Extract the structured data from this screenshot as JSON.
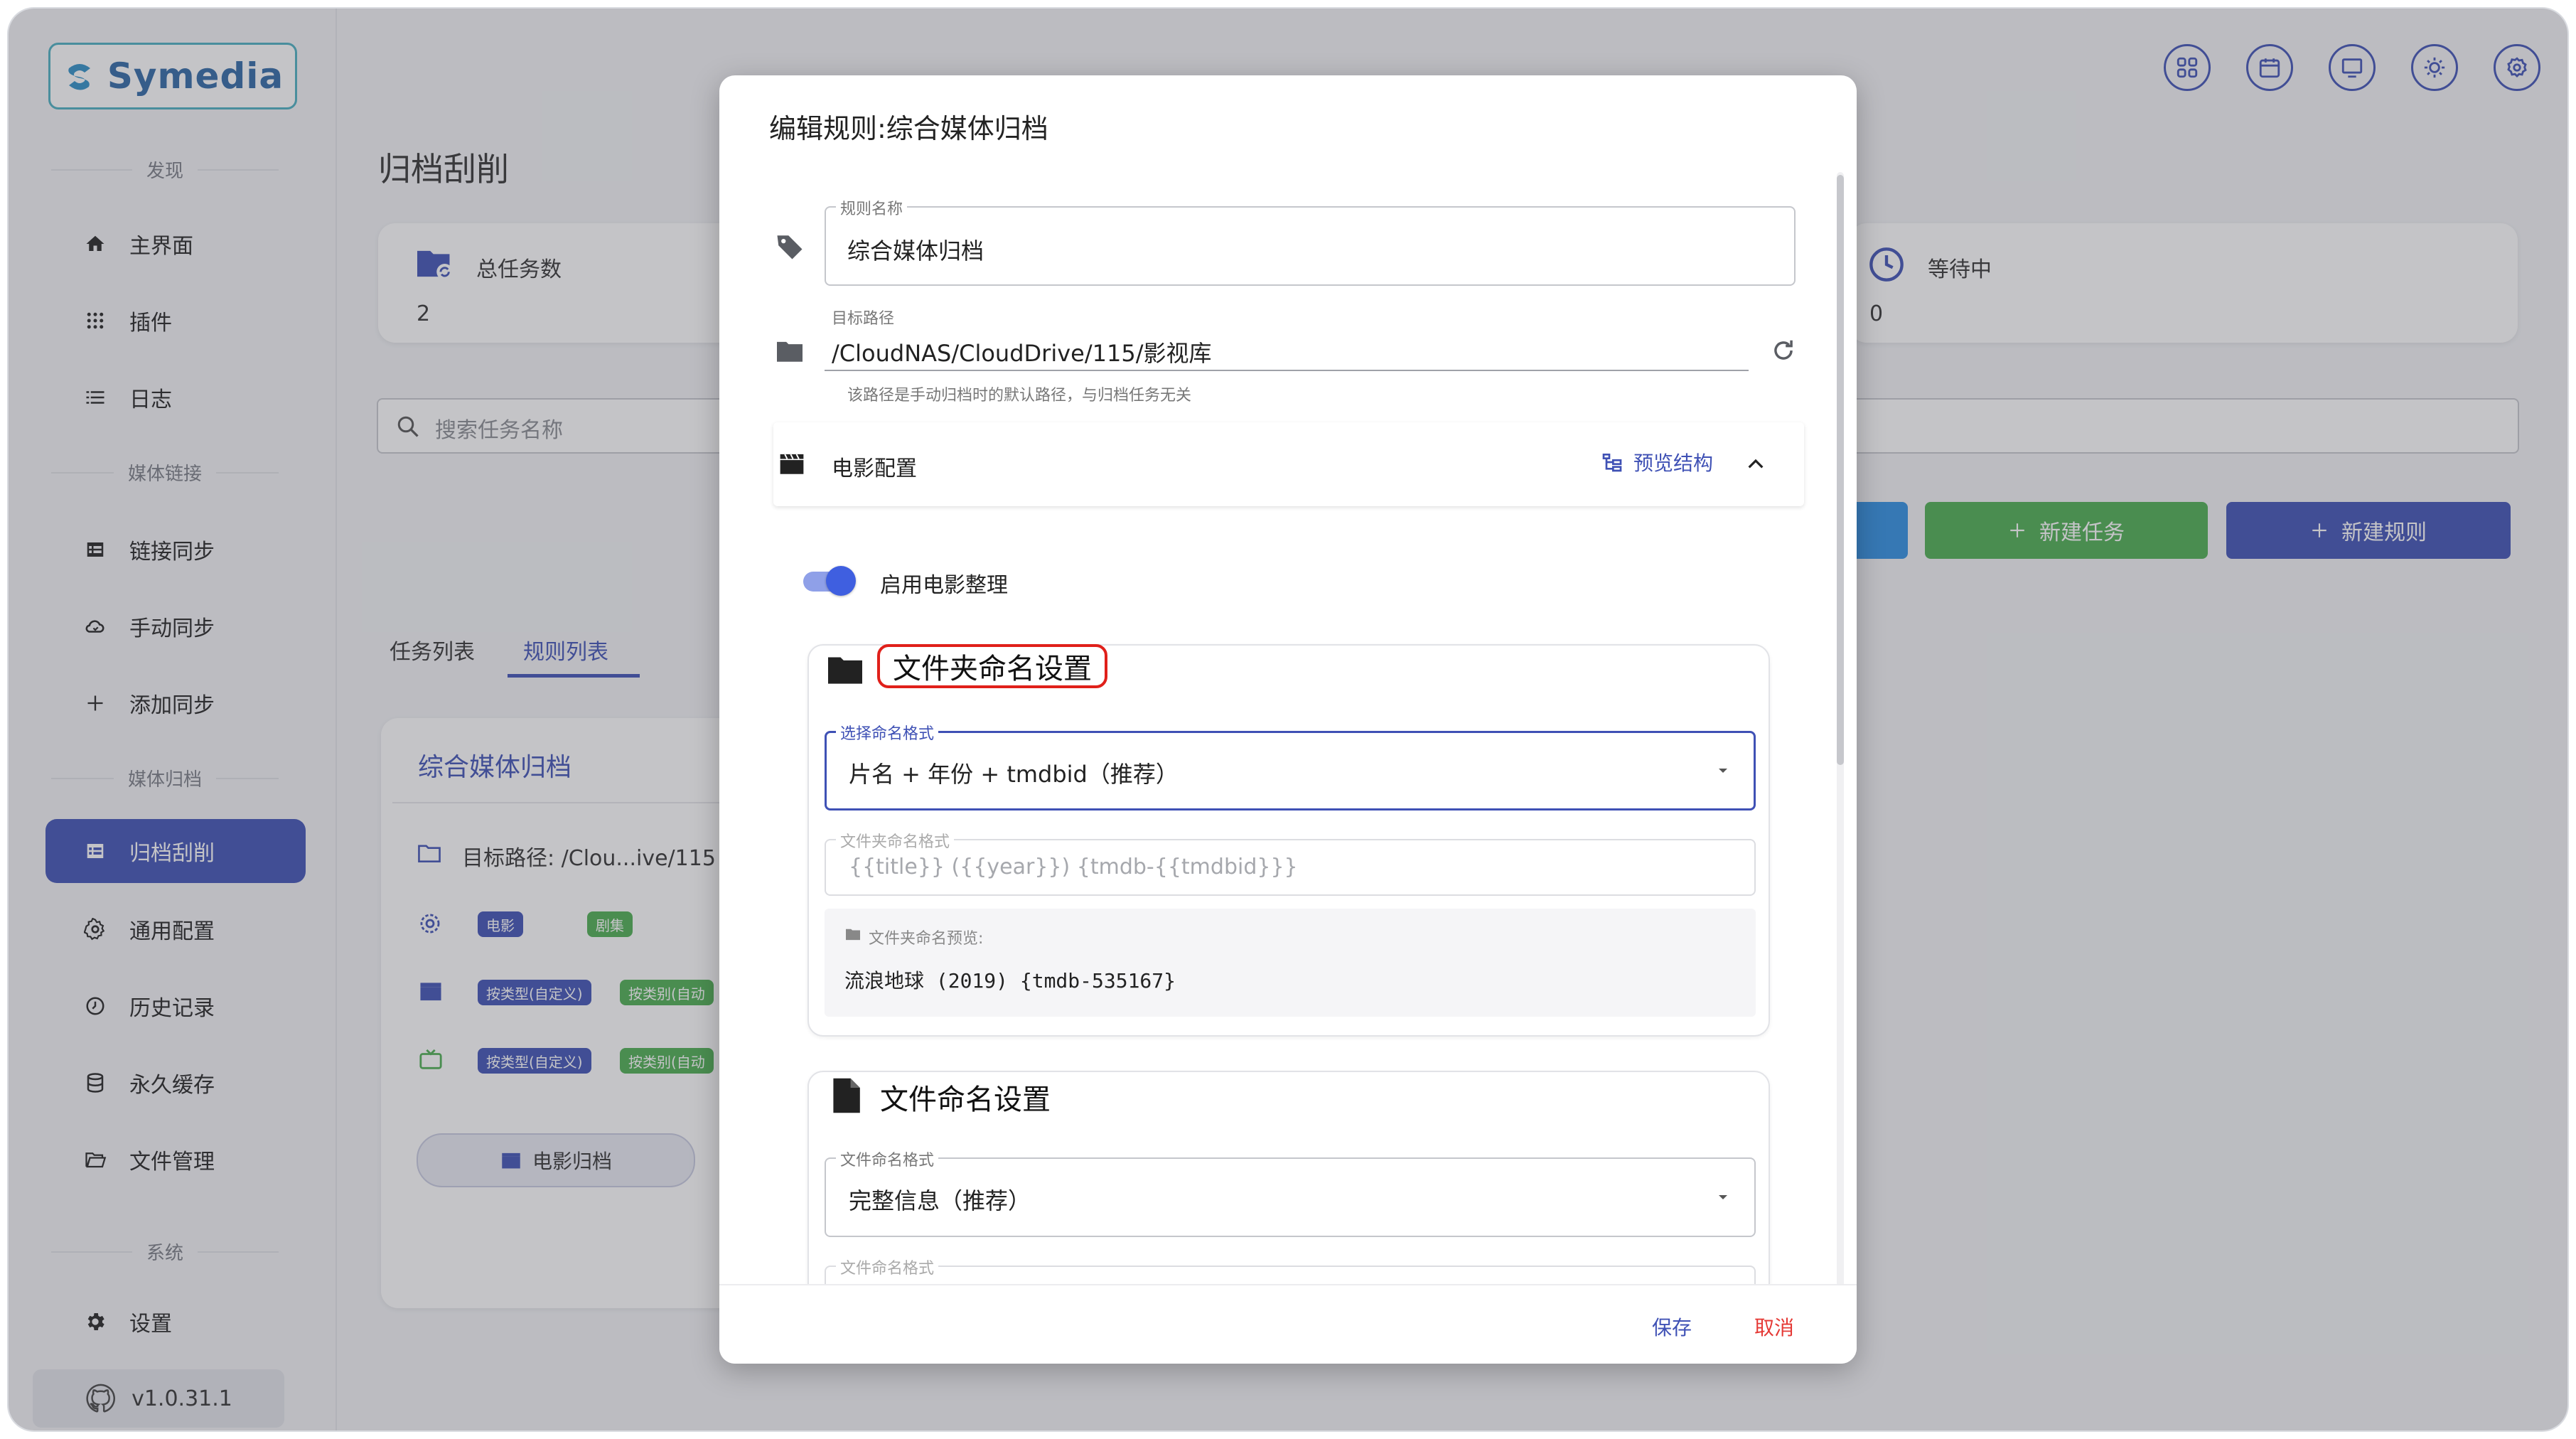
{
  "app": {
    "logo_text": "Symedia",
    "version": "v1.0.31.1"
  },
  "sidebar": {
    "sections": [
      {
        "title": "发现"
      },
      {
        "title": "媒体链接"
      },
      {
        "title": "媒体归档"
      },
      {
        "title": "系统"
      }
    ],
    "items": [
      {
        "label": "主界面",
        "icon": "home-icon"
      },
      {
        "label": "插件",
        "icon": "grid-icon"
      },
      {
        "label": "日志",
        "icon": "list-icon"
      },
      {
        "label": "链接同步",
        "icon": "table-icon"
      },
      {
        "label": "手动同步",
        "icon": "cloud-sync-icon"
      },
      {
        "label": "添加同步",
        "icon": "plus-icon"
      },
      {
        "label": "归档刮削",
        "icon": "table-icon",
        "active": true
      },
      {
        "label": "通用配置",
        "icon": "gear-icon"
      },
      {
        "label": "历史记录",
        "icon": "clock-icon"
      },
      {
        "label": "永久缓存",
        "icon": "database-icon"
      },
      {
        "label": "文件管理",
        "icon": "folder-open-icon"
      },
      {
        "label": "设置",
        "icon": "settings-icon"
      }
    ]
  },
  "main": {
    "title": "归档刮削",
    "stats": [
      {
        "label": "总任务数",
        "value": "2"
      },
      {
        "label": "等待中",
        "value": "0"
      }
    ],
    "search_placeholder": "搜索任务名称",
    "buttons": {
      "new_task": "新建任务",
      "new_rule": "新建规则"
    },
    "tabs": [
      {
        "label": "任务列表"
      },
      {
        "label": "规则列表",
        "active": true
      }
    ],
    "rule_card": {
      "title": "综合媒体归档",
      "target_path": "目标路径: /Clou...ive/115",
      "chips": [
        "电影",
        "剧集"
      ],
      "row_chips": [
        "按类型(自定义)",
        "按类别(自动"
      ],
      "button": "电影归档"
    }
  },
  "dialog": {
    "title": "编辑规则:综合媒体归档",
    "rule_name_label": "规则名称",
    "rule_name_value": "综合媒体归档",
    "target_path_label": "目标路径",
    "target_path_value": "/CloudNAS/CloudDrive/115/影视库",
    "target_path_hint": "该路径是手动归档时的默认路径，与归档任务无关",
    "section_title": "电影配置",
    "preview_button": "预览结构",
    "toggle_label": "启用电影整理",
    "toggle_on": true,
    "folder_panel": {
      "title": "文件夹命名设置",
      "select_label": "选择命名格式",
      "select_value": "片名 + 年份 + tmdbid（推荐）",
      "format_label": "文件夹命名格式",
      "format_value": "{{title}} ({{year}}) {tmdb-{{tmdbid}}}",
      "preview_label": "文件夹命名预览:",
      "preview_value": "流浪地球 (2019) {tmdb-535167}"
    },
    "file_panel": {
      "title": "文件命名设置",
      "select_label": "文件命名格式",
      "select_value": "完整信息（推荐）",
      "format_label": "文件命名格式"
    },
    "save": "保存",
    "cancel": "取消"
  },
  "colors": {
    "primary": "#3f51b5",
    "green": "#4caf50",
    "blue": "#2196f3",
    "danger": "#e53935",
    "highlight_border": "#e0201a"
  }
}
